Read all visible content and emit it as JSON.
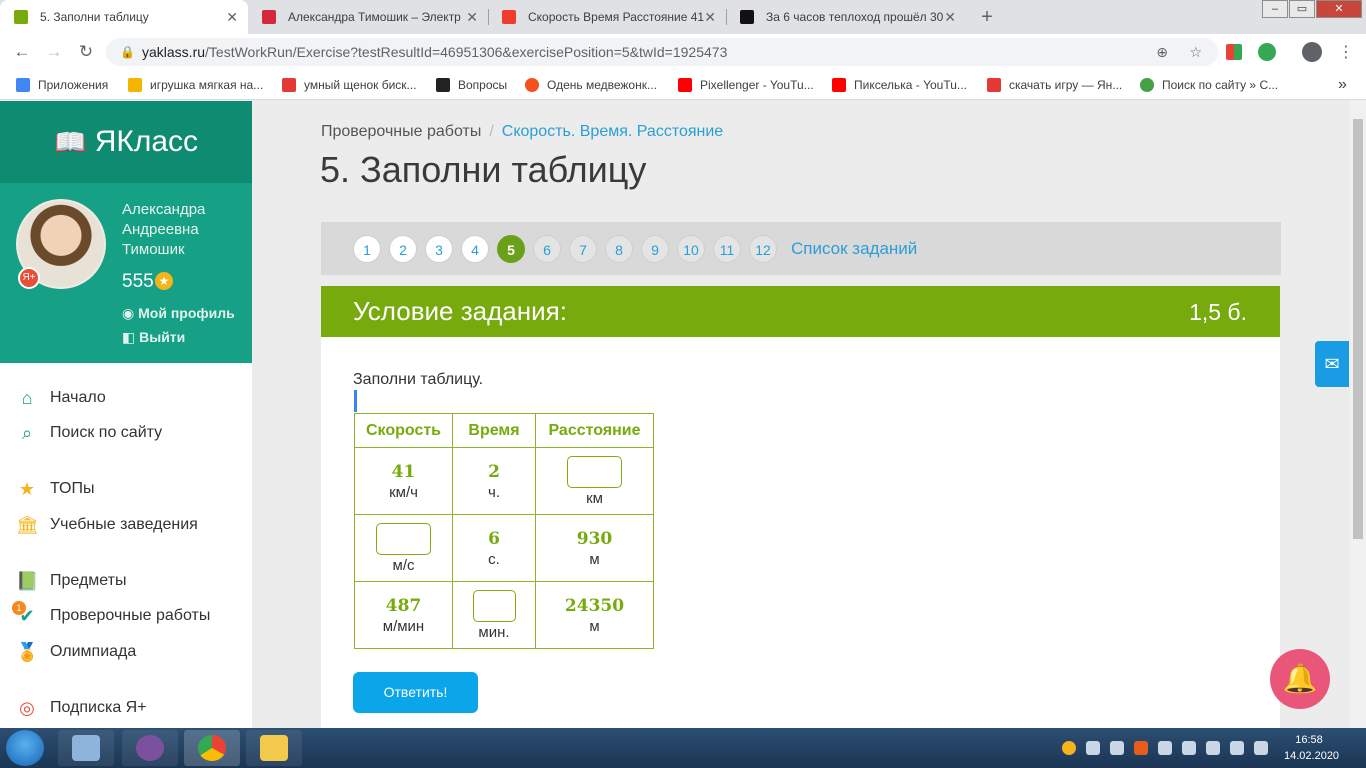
{
  "browser": {
    "tabs": [
      {
        "label": "5. Заполни таблицу",
        "icon_color": "#77aa0c"
      },
      {
        "label": "Александра Тимошик – Электр",
        "icon_color": "#d4283c"
      },
      {
        "label": "Скорость Время Расстояние 41",
        "icon_color": "#f03c2c"
      },
      {
        "label": "За 6 часов теплоход прошёл 30",
        "icon_color": "#111111"
      }
    ],
    "new_tab": "+",
    "close_glyph": "✕",
    "url_host": "yaklass.ru",
    "url_path": "/TestWorkRun/Exercise?testResultId=46951306&exercisePosition=5&twId=1925473",
    "bookmarks": [
      {
        "label": "Приложения",
        "icon_color": "#4285f4"
      },
      {
        "label": "игрушка мягкая на...",
        "icon_color": "#f4b400"
      },
      {
        "label": "умный щенок биск...",
        "icon_color": "#e53935"
      },
      {
        "label": "Вопросы",
        "icon_color": "#222222"
      },
      {
        "label": "Одень медвежонк...",
        "icon_color": "#f4511e"
      },
      {
        "label": "Pixellenger - YouTu...",
        "icon_color": "#ff0000"
      },
      {
        "label": "Пикселька - YouTu...",
        "icon_color": "#ff0000"
      },
      {
        "label": "скачать игру — Ян...",
        "icon_color": "#e53935"
      },
      {
        "label": "Поиск по сайту » С...",
        "icon_color": "#43a047"
      }
    ],
    "more_bookmarks": "»"
  },
  "sidebar": {
    "logo": "ЯКласс",
    "user_name_lines": [
      "Александра",
      "Андреевна",
      "Тимошик"
    ],
    "points": "555",
    "profile_link": "Мой профиль",
    "logout_link": "Выйти",
    "menu": [
      {
        "label": "Начало",
        "icon": "home-icon"
      },
      {
        "label": "Поиск по сайту",
        "icon": "search-icon"
      },
      {
        "label": "ТОПы",
        "icon": "star-icon"
      },
      {
        "label": "Учебные заведения",
        "icon": "school-icon"
      },
      {
        "label": "Предметы",
        "icon": "book-icon"
      },
      {
        "label": "Проверочные работы",
        "icon": "check-icon"
      },
      {
        "label": "Олимпиада",
        "icon": "medal-icon"
      },
      {
        "label": "Подписка Я+",
        "icon": "subscription-icon"
      }
    ],
    "tests_badge": "1"
  },
  "main": {
    "breadcrumb": {
      "root": "Проверочные работы",
      "current": "Скорость. Время. Расстояние"
    },
    "title": "5. Заполни таблицу",
    "pager": [
      "1",
      "2",
      "3",
      "4",
      "5",
      "6",
      "7",
      "8",
      "9",
      "10",
      "11",
      "12"
    ],
    "current_page": "5",
    "task_list_link": "Список заданий",
    "condition_title": "Условие задания:",
    "score": "1,5 б.",
    "instruction": "Заполни таблицу.",
    "table": {
      "headers": [
        "Скорость",
        "Время",
        "Расстояние"
      ],
      "rows": [
        [
          {
            "value": "41",
            "unit": "км/ч"
          },
          {
            "value": "2",
            "unit": "ч."
          },
          {
            "value": "",
            "unit": "км",
            "input": true
          }
        ],
        [
          {
            "value": "",
            "unit": "м/с",
            "input": true
          },
          {
            "value": "6",
            "unit": "с."
          },
          {
            "value": "930",
            "unit": "м"
          }
        ],
        [
          {
            "value": "487",
            "unit": "м/мин"
          },
          {
            "value": "",
            "unit": "мин.",
            "input": true
          },
          {
            "value": "24350",
            "unit": "м"
          }
        ]
      ]
    },
    "answer_button": "Ответить!"
  },
  "taskbar": {
    "time": "16:58",
    "date": "14.02.2020"
  },
  "colors": {
    "brand_green": "#77aa0c",
    "sidebar_teal": "#16a085",
    "link_blue": "#2a9fd6",
    "button_blue": "#0aa6e9"
  }
}
